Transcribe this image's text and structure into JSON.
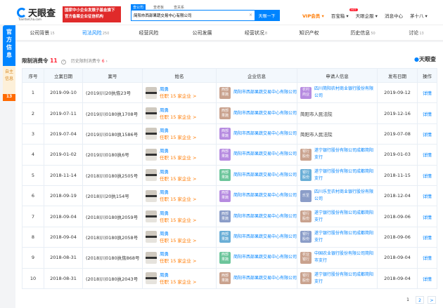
{
  "header": {
    "logo_text": "天眼查",
    "logo_url_text": "TianYanCha.com",
    "banner_lines": [
      "国家中小企业发展子基金旗下",
      "官方备案企业征信机构"
    ],
    "search_tabs": [
      "查公司",
      "查老板",
      "查关系"
    ],
    "search_value": "简阳市西部果蔬交易中心有限公司",
    "clear": "×",
    "search_button": "天眼一下",
    "nav": [
      "VIP会员 ▾",
      "百宝箱 ▾",
      "天眼企服 ▾",
      "消息中心",
      "茅十八 ▾"
    ],
    "hot": "HOT"
  },
  "side": {
    "official": "官方信息",
    "self": "自主信息",
    "self_count": "13"
  },
  "tabs": [
    {
      "label": "公司背景",
      "count": "15"
    },
    {
      "label": "司法风险",
      "count": "250"
    },
    {
      "label": "经营风险",
      "count": ""
    },
    {
      "label": "公司发展",
      "count": ""
    },
    {
      "label": "经营状况",
      "count": "8"
    },
    {
      "label": "知识产权",
      "count": ""
    },
    {
      "label": "历史信息",
      "count": "50"
    },
    {
      "label": "讨论",
      "count": "13"
    }
  ],
  "section": {
    "title": "限制消费令",
    "count": "11",
    "help": "?",
    "history": "历史限制消费令",
    "history_count": "6",
    "brand": "天眼查"
  },
  "columns": [
    "序号",
    "立案日期",
    "案号",
    "姓名",
    "企业信息",
    "申请人信息",
    "发布日期",
    "操作"
  ],
  "rows": [
    {
      "no": "1",
      "date": "2019-09-10",
      "case": "(2019)川20执恢23号",
      "person": "周勇",
      "job": "任职 15 家企业 >",
      "company": "简阳市西部果蔬交易中心有限公司",
      "ctag": "西部果蔬",
      "ccolor": "#c9a28e",
      "applicant": "四川简阳农村商业银行股份有限公司",
      "atag": "农村商业",
      "acolor": "#b68be0",
      "pub": "2019-09-12",
      "op": "详情"
    },
    {
      "no": "2",
      "date": "2019-07-11",
      "case": "(2019)川0180执1708号",
      "person": "周勇",
      "job": "任职 15 家企业 >",
      "company": "简阳市西部果蔬交易中心有限公司",
      "ctag": "西部果蔬",
      "ccolor": "#c9a28e",
      "applicant": "简阳市人民法院",
      "atag": "",
      "acolor": "",
      "pub": "2019-12-16",
      "op": "详情"
    },
    {
      "no": "3",
      "date": "2019-07-04",
      "case": "(2019)川0180执1586号",
      "person": "周勇",
      "job": "任职 15 家企业 >",
      "company": "简阳市西部果蔬交易中心有限公司",
      "ctag": "西部果蔬",
      "ccolor": "#b68be0",
      "applicant": "简阳市人民法院",
      "atag": "",
      "acolor": "",
      "pub": "2019-07-08",
      "op": "详情"
    },
    {
      "no": "4",
      "date": "2019-01-02",
      "case": "(2019)川0180执6号",
      "person": "周勇",
      "job": "任职 15 家企业 >",
      "company": "简阳市西部果蔬交易中心有限公司",
      "ctag": "西部果蔬",
      "ccolor": "#b68be0",
      "applicant": "遂宁银行股份有限公司成都简阳支行",
      "atag": "银行股份",
      "acolor": "#c9a28e",
      "pub": "2019-01-03",
      "op": "详情"
    },
    {
      "no": "5",
      "date": "2018-11-14",
      "case": "(2018)川0180执2505号",
      "person": "周勇",
      "job": "任职 15 家企业 >",
      "company": "简阳市西部果蔬交易中心有限公司",
      "ctag": "西部果蔬",
      "ccolor": "#6cc59b",
      "applicant": "遂宁银行股份有限公司成都简阳支行",
      "atag": "银行股份",
      "acolor": "#6aaed6",
      "pub": "2018-11-15",
      "op": "详情"
    },
    {
      "no": "6",
      "date": "2018-09-19",
      "case": "(2018)川20执154号",
      "person": "周勇",
      "job": "任职 15 家企业 >",
      "company": "简阳市西部果蔬交易中心有限公司",
      "ctag": "西部果蔬",
      "ccolor": "#b68be0",
      "applicant": "四川乐至农村商业银行股份有限公司",
      "atag": "乐至",
      "acolor": "#8b9dc8",
      "pub": "2018-12-04",
      "op": "详情"
    },
    {
      "no": "7",
      "date": "2018-09-04",
      "case": "(2018)川0180执2059号",
      "person": "周勇",
      "job": "任职 15 家企业 >",
      "company": "简阳市西部果蔬交易中心有限公司",
      "ctag": "西部果蔬",
      "ccolor": "#8b9dc8",
      "applicant": "遂宁银行股份有限公司成都简阳支行",
      "atag": "银行股份",
      "acolor": "#c9a28e",
      "pub": "2018-09-06",
      "op": "详情"
    },
    {
      "no": "8",
      "date": "2018-09-04",
      "case": "(2018)川0180执2058号",
      "person": "周勇",
      "job": "任职 15 家企业 >",
      "company": "简阳市西部果蔬交易中心有限公司",
      "ctag": "西部果蔬",
      "ccolor": "#6aaed6",
      "applicant": "遂宁银行股份有限公司成都简阳支行",
      "atag": "银行股份",
      "acolor": "#8b9dc8",
      "pub": "2018-09-06",
      "op": "详情"
    },
    {
      "no": "9",
      "date": "2018-08-31",
      "case": "(2018)川0180执恢868号",
      "person": "周勇",
      "job": "任职 15 家企业 >",
      "company": "简阳市西部果蔬交易中心有限公司",
      "ctag": "西部果蔬",
      "ccolor": "#6cc59b",
      "applicant": "中国农业银行股份有限公司简阳市支行",
      "atag": "农业银行",
      "acolor": "#c9a28e",
      "pub": "2018-09-04",
      "op": "详情"
    },
    {
      "no": "10",
      "date": "2018-08-31",
      "case": "(2018)川0180执2043号",
      "person": "周勇",
      "job": "任职 15 家企业 >",
      "company": "简阳市西部果蔬交易中心有限公司",
      "ctag": "西部果蔬",
      "ccolor": "#c9a28e",
      "applicant": "遂宁银行股份有限公司成都简阳支行",
      "atag": "银行股份",
      "acolor": "#c9a28e",
      "pub": "2018-09-04",
      "op": "详情"
    }
  ],
  "pager": {
    "pages": [
      "1",
      "2"
    ],
    "next": ">"
  }
}
